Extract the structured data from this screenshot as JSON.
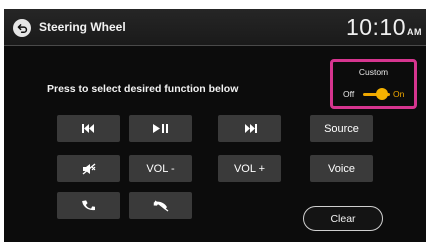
{
  "header": {
    "title": "Steering Wheel",
    "time": "10:10",
    "ampm": "AM"
  },
  "instruction": "Press to select desired function below",
  "custom": {
    "label": "Custom",
    "off_label": "Off",
    "on_label": "On",
    "state": "on"
  },
  "buttons": {
    "prev": {
      "icon": "skip-previous-icon"
    },
    "play_pause": {
      "icon": "play-pause-icon"
    },
    "next": {
      "icon": "skip-next-icon"
    },
    "source": {
      "label": "Source"
    },
    "mute": {
      "icon": "mute-icon"
    },
    "vol_down": {
      "label": "VOL -"
    },
    "vol_up": {
      "label": "VOL +"
    },
    "voice": {
      "label": "Voice"
    },
    "call": {
      "icon": "phone-call-icon"
    },
    "hangup": {
      "icon": "phone-hangup-icon"
    }
  },
  "clear_label": "Clear",
  "colors": {
    "accent": "#f0a800",
    "highlight_border": "#d6358f",
    "button_bg": "#3a3a3a",
    "screen_bg": "#0c0c0c"
  }
}
